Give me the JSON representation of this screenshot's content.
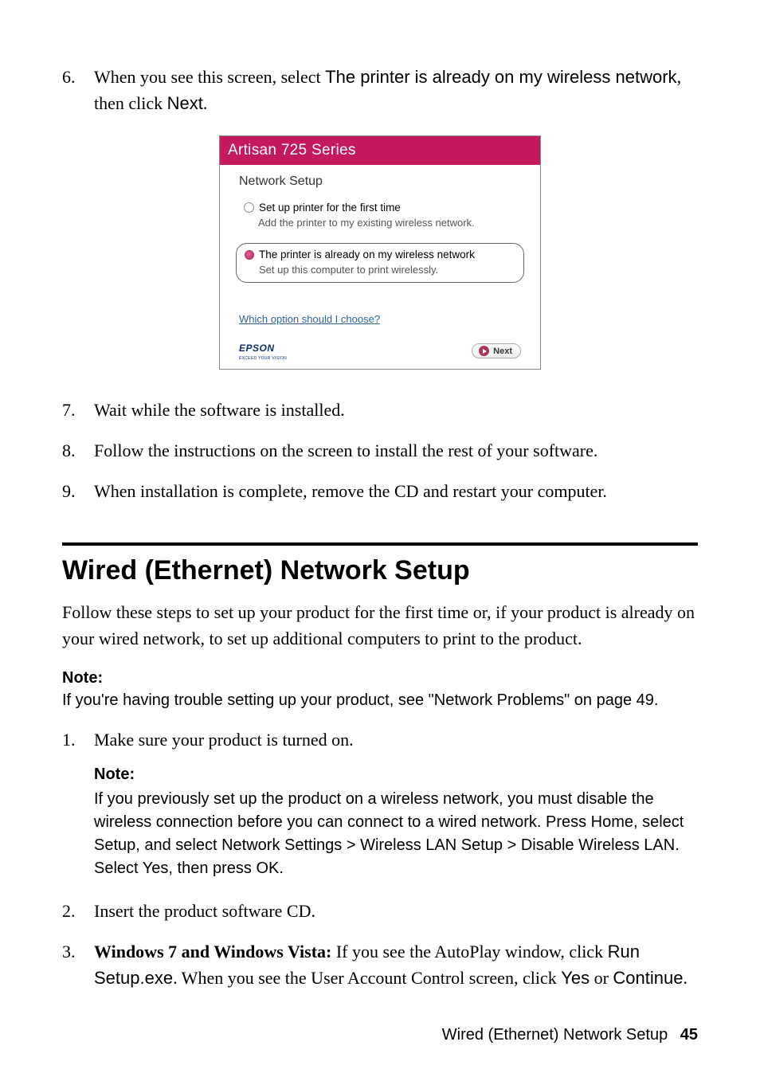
{
  "steps_top": {
    "s6": {
      "num": "6.",
      "pre": "When you see this screen, select ",
      "opt": "The printer is already on my wireless network",
      "mid": ", then click ",
      "btn": "Next",
      "post": "."
    },
    "s7": {
      "num": "7.",
      "text": "Wait while the software is installed."
    },
    "s8": {
      "num": "8.",
      "text": "Follow the instructions on the screen to install the rest of your software."
    },
    "s9": {
      "num": "9.",
      "text": "When installation is complete, remove the CD and restart your computer."
    }
  },
  "dialog": {
    "title": "Artisan 725 Series",
    "subtitle": "Network Setup",
    "opt1_label": "Set up printer for the first time",
    "opt1_desc": "Add the printer to my existing wireless network.",
    "opt2_label": "The printer is already on my wireless network",
    "opt2_desc": "Set up this computer to print wirelessly.",
    "help": "Which option should I choose?",
    "brand": "EPSON",
    "brand_sub": "EXCEED YOUR VISION",
    "next": "Next"
  },
  "section": {
    "heading": "Wired (Ethernet) Network Setup",
    "intro": "Follow these steps to set up your product for the first time or, if your product is already on your wired network, to set up additional computers to print to the product.",
    "note_label": "Note:",
    "note_text": "If you're having trouble setting up your product, see \"Network Problems\" on page 49."
  },
  "steps_bottom": {
    "s1": {
      "num": "1.",
      "text": "Make sure your product is turned on."
    },
    "s1_note_label": "Note:",
    "s1_note": {
      "pre": "If you previously set up the product on a wireless network, you must disable the wireless connection before you can connect to a wired network. Press Home, select Setup, and select ",
      "path": "Network Settings > Wireless LAN Setup > Disable Wireless LAN",
      "mid1": ". Select ",
      "yes": "Yes",
      "mid2": ", then press ",
      "ok": "OK",
      "post": "."
    },
    "s2": {
      "num": "2.",
      "text": "Insert the product software CD."
    },
    "s3": {
      "num": "3.",
      "lead_bold": "Windows 7 and Windows Vista:",
      "lead_rest": " If you see the AutoPlay window, click ",
      "run": "Run Setup.exe",
      "mid": ". When you see the User Account Control screen, click ",
      "yes": "Yes",
      "or": " or ",
      "cont": "Continue",
      "post": "."
    }
  },
  "footer": {
    "label": "Wired (Ethernet) Network Setup",
    "page": "45"
  }
}
